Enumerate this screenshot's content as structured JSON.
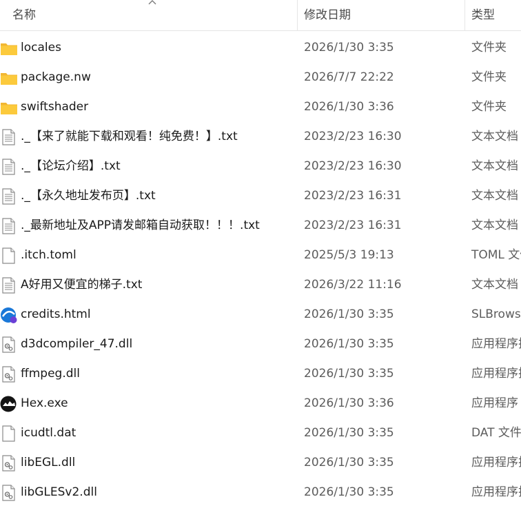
{
  "header": {
    "name": "名称",
    "date": "修改日期",
    "type": "类型"
  },
  "files": [
    {
      "name": "locales",
      "date": "2026/1/30 3:35",
      "type": "文件夹",
      "icon": "folder-icon"
    },
    {
      "name": "package.nw",
      "date": "2026/7/7 22:22",
      "type": "文件夹",
      "icon": "folder-icon"
    },
    {
      "name": "swiftshader",
      "date": "2026/1/30 3:36",
      "type": "文件夹",
      "icon": "folder-icon"
    },
    {
      "name": "._【来了就能下载和观看！纯免费！】.txt",
      "date": "2023/2/23 16:30",
      "type": "文本文档",
      "icon": "text-file-icon"
    },
    {
      "name": "._【论坛介绍】.txt",
      "date": "2023/2/23 16:30",
      "type": "文本文档",
      "icon": "text-file-icon"
    },
    {
      "name": "._【永久地址发布页】.txt",
      "date": "2023/2/23 16:31",
      "type": "文本文档",
      "icon": "text-file-icon"
    },
    {
      "name": "._最新地址及APP请发邮箱自动获取！！！.txt",
      "date": "2023/2/23 16:31",
      "type": "文本文档",
      "icon": "text-file-icon"
    },
    {
      "name": ".itch.toml",
      "date": "2025/5/3 19:13",
      "type": "TOML 文件",
      "icon": "blank-file-icon"
    },
    {
      "name": "A好用又便宜的梯子.txt",
      "date": "2026/3/22 11:16",
      "type": "文本文档",
      "icon": "text-file-icon"
    },
    {
      "name": "credits.html",
      "date": "2026/1/30 3:35",
      "type": "SLBrowser",
      "icon": "browser-icon"
    },
    {
      "name": "d3dcompiler_47.dll",
      "date": "2026/1/30 3:35",
      "type": "应用程序扩展",
      "icon": "dll-file-icon"
    },
    {
      "name": "ffmpeg.dll",
      "date": "2026/1/30 3:35",
      "type": "应用程序扩展",
      "icon": "dll-file-icon"
    },
    {
      "name": "Hex.exe",
      "date": "2026/1/30 3:36",
      "type": "应用程序",
      "icon": "hex-app-icon"
    },
    {
      "name": "icudtl.dat",
      "date": "2026/1/30 3:35",
      "type": "DAT 文件",
      "icon": "blank-file-icon"
    },
    {
      "name": "libEGL.dll",
      "date": "2026/1/30 3:35",
      "type": "应用程序扩展",
      "icon": "dll-file-icon"
    },
    {
      "name": "libGLESv2.dll",
      "date": "2026/1/30 3:35",
      "type": "应用程序扩展",
      "icon": "dll-file-icon"
    }
  ]
}
